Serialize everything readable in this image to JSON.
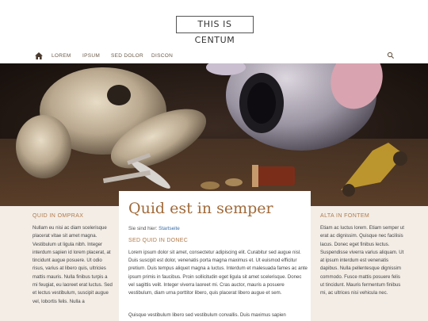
{
  "site": {
    "logo": "THIS IS CENTUM"
  },
  "nav": {
    "items": [
      "LOREM",
      "IPSUM",
      "SED DOLOR",
      "DISCON"
    ],
    "home_icon": "home-icon",
    "search_icon": "search-icon"
  },
  "left": {
    "heading": "QUID IN OMPRAX",
    "text": "Nullam eu nisi ac diam scelerisque placerat vitae sit amet magna. Vestibulum ut ligula nibh. Integer interdum sapien id lorem placerat, at tincidunt augue posuere. Ut odio risus, varius at libero quis, ultricies mattis mauris. Nulla finibus turpis a mi feugiat, eu laoreet erat luctus. Sed et lectus vestibulum, suscipit augue vel, lobortis felis. Nulla a"
  },
  "main": {
    "title": "Quid est in semper",
    "breadcrumb_prefix": "Sie sind hier:",
    "breadcrumb_link": "Startseite",
    "subheading": "SED QUID IN DONEC",
    "paragraph1": "Lorem ipsum dolor sit amet, consectetur adipiscing elit. Curabitur sed augue nisl. Duis suscipit est dolor, venenatis porta magna maximus et. Ut euismod efficitur pretium. Duis tempus aliquet magna a luctus. Interdum et malesuada fames ac ante ipsum primis in faucibus. Proin sollicitudin eget ligula sit amet scelerisque. Donec vel sagittis velit. Integer viverra laoreet mi. Cras auctor, mauris a posuere vestibulum, diam urna porttitor libero, quis placerat libero augue et sem.",
    "paragraph2": "Quisque vestibulum libero sed vestibulum convallis. Duis maximus sapien"
  },
  "right": {
    "heading": "ALTA IN FONTEM",
    "text": "Etiam ac luctus lorem. Etiam semper ut erat ac dignissim. Quisque nec facilisis lacus. Donec eget finibus lectus. Suspendisse viverra varius aliquam. Ut at ipsum interdum est venenatis dapibus. Nulla pellentesque dignissim commodo. Fusce mattis posuere felis ut tincidunt. Mauris fermentum finibus mi, ac ultrices nisi vehicula nec."
  },
  "colors": {
    "accent": "#b07a4a",
    "title": "#a06a3a",
    "sidebar_bg": "#f3ede6",
    "link": "#3a6ea5"
  }
}
